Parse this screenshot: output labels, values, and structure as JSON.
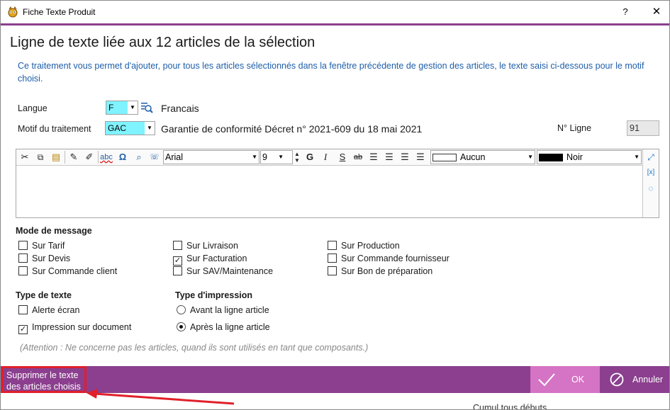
{
  "window": {
    "title": "Fiche Texte Produit",
    "help": "?",
    "close": "✕"
  },
  "heading": "Ligne de texte liée aux 12 articles de la sélection",
  "info": "Ce traitement vous permet d'ajouter, pour tous les articles sélectionnés dans la fenêtre précédente de gestion des articles, le texte saisi ci-dessous pour le motif choisi.",
  "langue": {
    "label": "Langue",
    "code": "F",
    "name": "Francais"
  },
  "motif": {
    "label": "Motif du traitement",
    "code": "GAC",
    "description": "Garantie de conformité Décret n° 2021-609 du 18 mai 2021"
  },
  "ligne": {
    "label": "N° Ligne",
    "value": "91"
  },
  "toolbar": {
    "font": "Arial",
    "size": "9",
    "bold": "G",
    "italic": "I",
    "shadow": "S",
    "strike": "ab",
    "background": "Aucun",
    "color": "Noir"
  },
  "mode_message": {
    "title": "Mode de message",
    "options": [
      {
        "label": "Sur Tarif",
        "checked": false
      },
      {
        "label": "Sur Devis",
        "checked": false
      },
      {
        "label": "Sur Commande client",
        "checked": false
      },
      {
        "label": "Sur Livraison",
        "checked": false
      },
      {
        "label": "Sur Facturation",
        "checked": true
      },
      {
        "label": "Sur SAV/Maintenance",
        "checked": false
      },
      {
        "label": "Sur Production",
        "checked": false
      },
      {
        "label": "Sur Commande fournisseur",
        "checked": false
      },
      {
        "label": "Sur Bon de préparation",
        "checked": false
      }
    ]
  },
  "type_texte": {
    "title": "Type de texte",
    "options": [
      {
        "label": "Alerte écran",
        "checked": false
      },
      {
        "label": "Impression sur document",
        "checked": true
      }
    ]
  },
  "type_impression": {
    "title": "Type d'impression",
    "options": [
      {
        "label": "Avant la ligne article",
        "selected": false
      },
      {
        "label": "Après la ligne article",
        "selected": true
      }
    ]
  },
  "note": "(Attention : Ne concerne pas les articles, quand ils sont utilisés en tant que composants.)",
  "footer": {
    "left_line1": "Supprimer le texte",
    "left_line2": "des articles choisis",
    "ok": "OK",
    "cancel": "Annuler"
  },
  "background_partial": "Cumul tous débuts",
  "colors": {
    "accent": "#8b3f8e",
    "ok_button": "#d573c4",
    "info_text": "#1f5fa8",
    "highlight": "#7ff3ff",
    "annotation": "#e0202a"
  }
}
